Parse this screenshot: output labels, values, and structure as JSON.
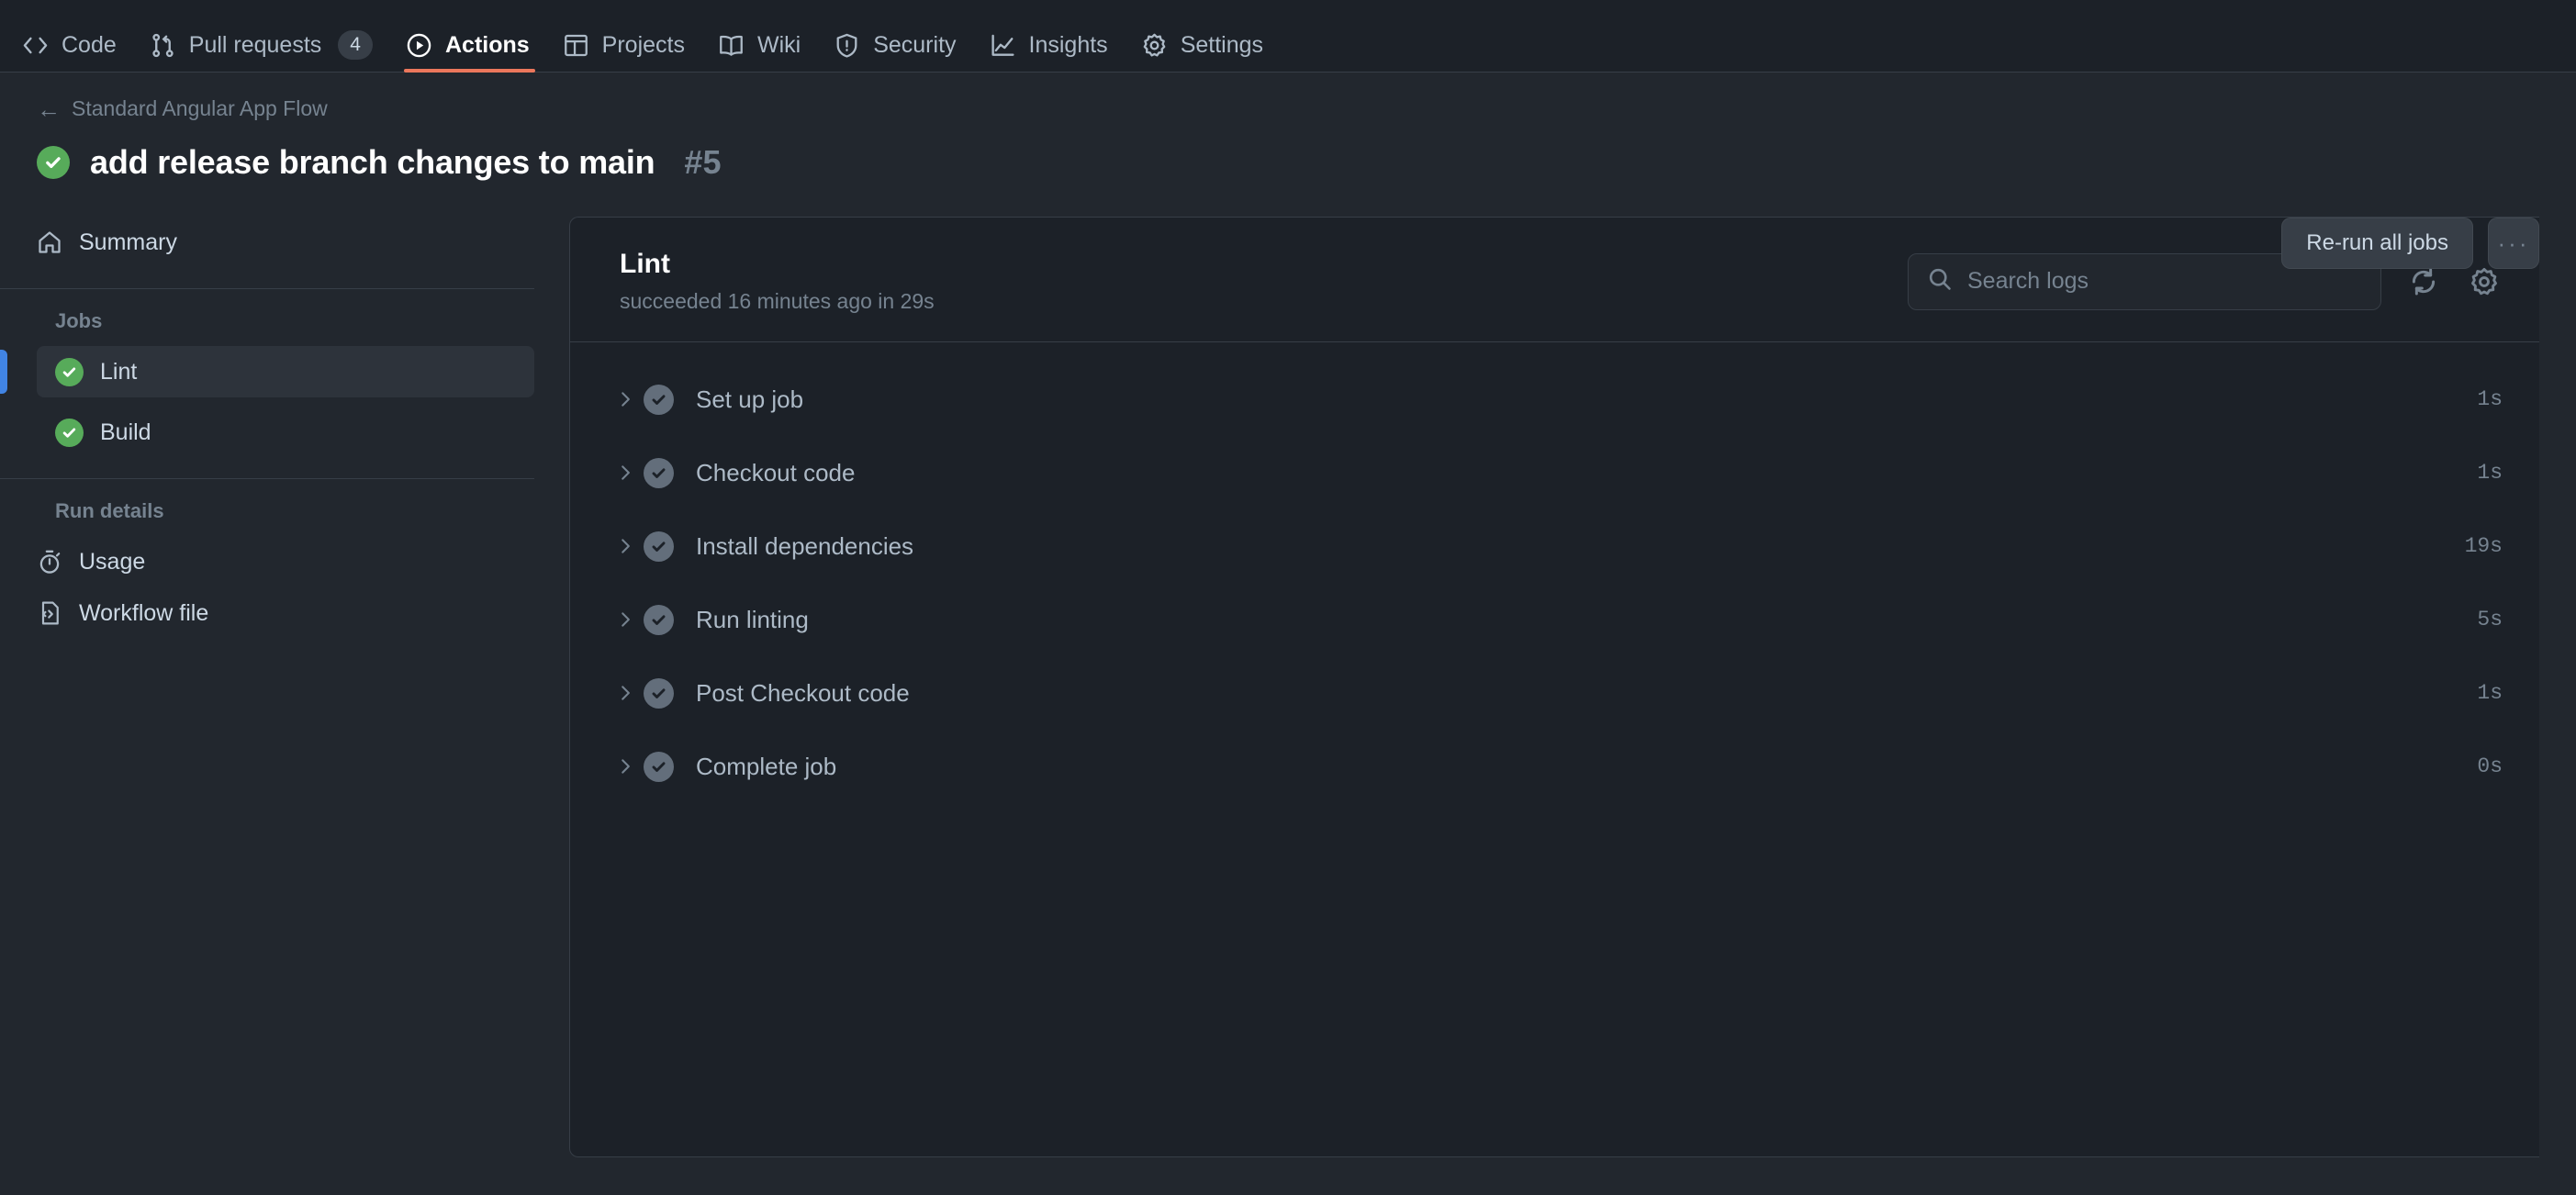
{
  "repo_nav": {
    "items": [
      {
        "label": "Code",
        "icon": "code-icon",
        "selected": false,
        "count": null
      },
      {
        "label": "Pull requests",
        "icon": "git-pull-request-icon",
        "selected": false,
        "count": "4"
      },
      {
        "label": "Actions",
        "icon": "play-circle-icon",
        "selected": true,
        "count": null
      },
      {
        "label": "Projects",
        "icon": "table-icon",
        "selected": false,
        "count": null
      },
      {
        "label": "Wiki",
        "icon": "book-icon",
        "selected": false,
        "count": null
      },
      {
        "label": "Security",
        "icon": "shield-alert-icon",
        "selected": false,
        "count": null
      },
      {
        "label": "Insights",
        "icon": "graph-icon",
        "selected": false,
        "count": null
      },
      {
        "label": "Settings",
        "icon": "gear-icon",
        "selected": false,
        "count": null
      }
    ]
  },
  "run_header": {
    "breadcrumb_label": "Standard Angular App Flow",
    "back_arrow": "←",
    "status_icon": "check-circle-green-icon",
    "title": "add release branch changes to main",
    "run_number": "#5",
    "rerun_button_label": "Re-run all jobs",
    "more_button_label": "···"
  },
  "sidebar": {
    "summary": {
      "label": "Summary",
      "icon": "home-icon"
    },
    "jobs_section_title": "Jobs",
    "jobs": [
      {
        "label": "Lint",
        "icon": "check-circle-green-icon",
        "active": true
      },
      {
        "label": "Build",
        "icon": "check-circle-green-icon",
        "active": false
      }
    ],
    "run_details_section_title": "Run details",
    "run_details": [
      {
        "label": "Usage",
        "icon": "stopwatch-icon"
      },
      {
        "label": "Workflow file",
        "icon": "workflow-file-icon"
      }
    ]
  },
  "job_panel": {
    "name": "Lint",
    "status": "succeeded 16 minutes ago in 29s",
    "search": {
      "placeholder": "Search logs",
      "value": "",
      "icon": "search-icon"
    },
    "refresh_icon": "refresh-icon",
    "settings_icon": "gear-icon",
    "steps": [
      {
        "name": "Set up job",
        "duration": "1s",
        "status_icon": "check-circle-gray-icon"
      },
      {
        "name": "Checkout code",
        "duration": "1s",
        "status_icon": "check-circle-gray-icon"
      },
      {
        "name": "Install dependencies",
        "duration": "19s",
        "status_icon": "check-circle-gray-icon"
      },
      {
        "name": "Run linting",
        "duration": "5s",
        "status_icon": "check-circle-gray-icon"
      },
      {
        "name": "Post Checkout code",
        "duration": "1s",
        "status_icon": "check-circle-gray-icon"
      },
      {
        "name": "Complete job",
        "duration": "0s",
        "status_icon": "check-circle-gray-icon"
      }
    ]
  },
  "colors": {
    "accent": "#ec775c",
    "success": "#57ab5a",
    "active_indicator": "#4184e4",
    "page_bg": "#22272e",
    "panel_bg": "#1c2128",
    "border": "#373e47"
  }
}
